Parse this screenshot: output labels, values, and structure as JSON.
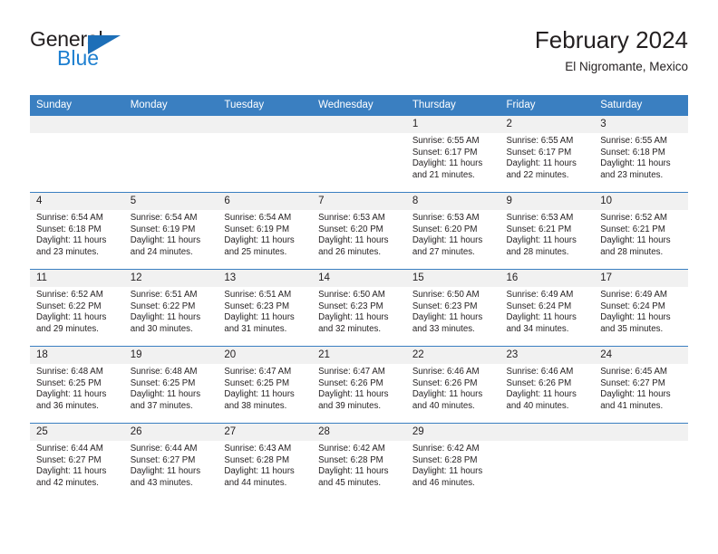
{
  "brand": {
    "word_one": "General",
    "word_two": "Blue",
    "accent_color": "#1d7fd0",
    "triangle_color": "#1d6fb8"
  },
  "header": {
    "title": "February 2024",
    "subtitle": "El Nigromante, Mexico"
  },
  "theme": {
    "header_bg": "#3a7fc1",
    "daynum_bg": "#f1f1f1",
    "grid_line": "#3a7fc1",
    "text": "#231f20"
  },
  "weekdays": [
    "Sunday",
    "Monday",
    "Tuesday",
    "Wednesday",
    "Thursday",
    "Friday",
    "Saturday"
  ],
  "weeks": [
    [
      {
        "day": "",
        "sunrise": "",
        "sunset": "",
        "daylight_1": "",
        "daylight_2": ""
      },
      {
        "day": "",
        "sunrise": "",
        "sunset": "",
        "daylight_1": "",
        "daylight_2": ""
      },
      {
        "day": "",
        "sunrise": "",
        "sunset": "",
        "daylight_1": "",
        "daylight_2": ""
      },
      {
        "day": "",
        "sunrise": "",
        "sunset": "",
        "daylight_1": "",
        "daylight_2": ""
      },
      {
        "day": "1",
        "sunrise": "Sunrise: 6:55 AM",
        "sunset": "Sunset: 6:17 PM",
        "daylight_1": "Daylight: 11 hours",
        "daylight_2": "and 21 minutes."
      },
      {
        "day": "2",
        "sunrise": "Sunrise: 6:55 AM",
        "sunset": "Sunset: 6:17 PM",
        "daylight_1": "Daylight: 11 hours",
        "daylight_2": "and 22 minutes."
      },
      {
        "day": "3",
        "sunrise": "Sunrise: 6:55 AM",
        "sunset": "Sunset: 6:18 PM",
        "daylight_1": "Daylight: 11 hours",
        "daylight_2": "and 23 minutes."
      }
    ],
    [
      {
        "day": "4",
        "sunrise": "Sunrise: 6:54 AM",
        "sunset": "Sunset: 6:18 PM",
        "daylight_1": "Daylight: 11 hours",
        "daylight_2": "and 23 minutes."
      },
      {
        "day": "5",
        "sunrise": "Sunrise: 6:54 AM",
        "sunset": "Sunset: 6:19 PM",
        "daylight_1": "Daylight: 11 hours",
        "daylight_2": "and 24 minutes."
      },
      {
        "day": "6",
        "sunrise": "Sunrise: 6:54 AM",
        "sunset": "Sunset: 6:19 PM",
        "daylight_1": "Daylight: 11 hours",
        "daylight_2": "and 25 minutes."
      },
      {
        "day": "7",
        "sunrise": "Sunrise: 6:53 AM",
        "sunset": "Sunset: 6:20 PM",
        "daylight_1": "Daylight: 11 hours",
        "daylight_2": "and 26 minutes."
      },
      {
        "day": "8",
        "sunrise": "Sunrise: 6:53 AM",
        "sunset": "Sunset: 6:20 PM",
        "daylight_1": "Daylight: 11 hours",
        "daylight_2": "and 27 minutes."
      },
      {
        "day": "9",
        "sunrise": "Sunrise: 6:53 AM",
        "sunset": "Sunset: 6:21 PM",
        "daylight_1": "Daylight: 11 hours",
        "daylight_2": "and 28 minutes."
      },
      {
        "day": "10",
        "sunrise": "Sunrise: 6:52 AM",
        "sunset": "Sunset: 6:21 PM",
        "daylight_1": "Daylight: 11 hours",
        "daylight_2": "and 28 minutes."
      }
    ],
    [
      {
        "day": "11",
        "sunrise": "Sunrise: 6:52 AM",
        "sunset": "Sunset: 6:22 PM",
        "daylight_1": "Daylight: 11 hours",
        "daylight_2": "and 29 minutes."
      },
      {
        "day": "12",
        "sunrise": "Sunrise: 6:51 AM",
        "sunset": "Sunset: 6:22 PM",
        "daylight_1": "Daylight: 11 hours",
        "daylight_2": "and 30 minutes."
      },
      {
        "day": "13",
        "sunrise": "Sunrise: 6:51 AM",
        "sunset": "Sunset: 6:23 PM",
        "daylight_1": "Daylight: 11 hours",
        "daylight_2": "and 31 minutes."
      },
      {
        "day": "14",
        "sunrise": "Sunrise: 6:50 AM",
        "sunset": "Sunset: 6:23 PM",
        "daylight_1": "Daylight: 11 hours",
        "daylight_2": "and 32 minutes."
      },
      {
        "day": "15",
        "sunrise": "Sunrise: 6:50 AM",
        "sunset": "Sunset: 6:23 PM",
        "daylight_1": "Daylight: 11 hours",
        "daylight_2": "and 33 minutes."
      },
      {
        "day": "16",
        "sunrise": "Sunrise: 6:49 AM",
        "sunset": "Sunset: 6:24 PM",
        "daylight_1": "Daylight: 11 hours",
        "daylight_2": "and 34 minutes."
      },
      {
        "day": "17",
        "sunrise": "Sunrise: 6:49 AM",
        "sunset": "Sunset: 6:24 PM",
        "daylight_1": "Daylight: 11 hours",
        "daylight_2": "and 35 minutes."
      }
    ],
    [
      {
        "day": "18",
        "sunrise": "Sunrise: 6:48 AM",
        "sunset": "Sunset: 6:25 PM",
        "daylight_1": "Daylight: 11 hours",
        "daylight_2": "and 36 minutes."
      },
      {
        "day": "19",
        "sunrise": "Sunrise: 6:48 AM",
        "sunset": "Sunset: 6:25 PM",
        "daylight_1": "Daylight: 11 hours",
        "daylight_2": "and 37 minutes."
      },
      {
        "day": "20",
        "sunrise": "Sunrise: 6:47 AM",
        "sunset": "Sunset: 6:25 PM",
        "daylight_1": "Daylight: 11 hours",
        "daylight_2": "and 38 minutes."
      },
      {
        "day": "21",
        "sunrise": "Sunrise: 6:47 AM",
        "sunset": "Sunset: 6:26 PM",
        "daylight_1": "Daylight: 11 hours",
        "daylight_2": "and 39 minutes."
      },
      {
        "day": "22",
        "sunrise": "Sunrise: 6:46 AM",
        "sunset": "Sunset: 6:26 PM",
        "daylight_1": "Daylight: 11 hours",
        "daylight_2": "and 40 minutes."
      },
      {
        "day": "23",
        "sunrise": "Sunrise: 6:46 AM",
        "sunset": "Sunset: 6:26 PM",
        "daylight_1": "Daylight: 11 hours",
        "daylight_2": "and 40 minutes."
      },
      {
        "day": "24",
        "sunrise": "Sunrise: 6:45 AM",
        "sunset": "Sunset: 6:27 PM",
        "daylight_1": "Daylight: 11 hours",
        "daylight_2": "and 41 minutes."
      }
    ],
    [
      {
        "day": "25",
        "sunrise": "Sunrise: 6:44 AM",
        "sunset": "Sunset: 6:27 PM",
        "daylight_1": "Daylight: 11 hours",
        "daylight_2": "and 42 minutes."
      },
      {
        "day": "26",
        "sunrise": "Sunrise: 6:44 AM",
        "sunset": "Sunset: 6:27 PM",
        "daylight_1": "Daylight: 11 hours",
        "daylight_2": "and 43 minutes."
      },
      {
        "day": "27",
        "sunrise": "Sunrise: 6:43 AM",
        "sunset": "Sunset: 6:28 PM",
        "daylight_1": "Daylight: 11 hours",
        "daylight_2": "and 44 minutes."
      },
      {
        "day": "28",
        "sunrise": "Sunrise: 6:42 AM",
        "sunset": "Sunset: 6:28 PM",
        "daylight_1": "Daylight: 11 hours",
        "daylight_2": "and 45 minutes."
      },
      {
        "day": "29",
        "sunrise": "Sunrise: 6:42 AM",
        "sunset": "Sunset: 6:28 PM",
        "daylight_1": "Daylight: 11 hours",
        "daylight_2": "and 46 minutes."
      },
      {
        "day": "",
        "sunrise": "",
        "sunset": "",
        "daylight_1": "",
        "daylight_2": ""
      },
      {
        "day": "",
        "sunrise": "",
        "sunset": "",
        "daylight_1": "",
        "daylight_2": ""
      }
    ]
  ]
}
